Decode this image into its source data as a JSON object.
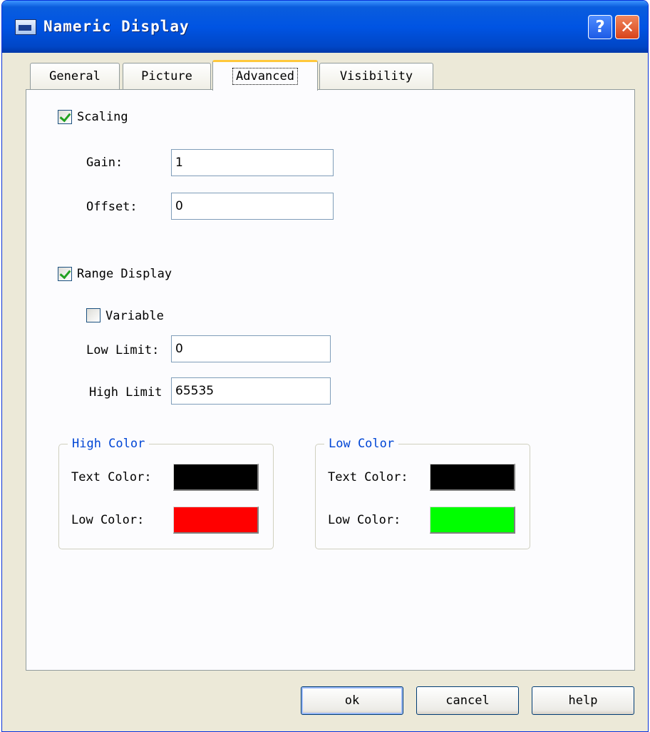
{
  "window": {
    "title": "Nameric Display"
  },
  "titlebar_buttons": {
    "help": "?",
    "close": "✕"
  },
  "tabs": [
    {
      "label": "General"
    },
    {
      "label": "Picture"
    },
    {
      "label": "Advanced",
      "active": true
    },
    {
      "label": "Visibility"
    }
  ],
  "scaling": {
    "label": "Scaling",
    "checked": true,
    "gain_label": "Gain:",
    "gain_value": "1",
    "offset_label": "Offset:",
    "offset_value": "0"
  },
  "range_display": {
    "label": "Range Display",
    "checked": true,
    "variable_label": "Variable",
    "variable_checked": false,
    "low_limit_label": "Low Limit:",
    "low_limit_value": "0",
    "high_limit_label": "High Limit",
    "high_limit_value": "65535"
  },
  "high_color": {
    "legend": "High Color",
    "text_color_label": "Text Color:",
    "text_color": "#000000",
    "low_color_label": "Low Color:",
    "low_color": "#ff0000"
  },
  "low_color": {
    "legend": "Low Color",
    "text_color_label": "Text Color:",
    "text_color": "#000000",
    "low_color_label": "Low Color:",
    "low_color": "#00ff00"
  },
  "buttons": {
    "ok": "ok",
    "cancel": "cancel",
    "help": "help"
  }
}
